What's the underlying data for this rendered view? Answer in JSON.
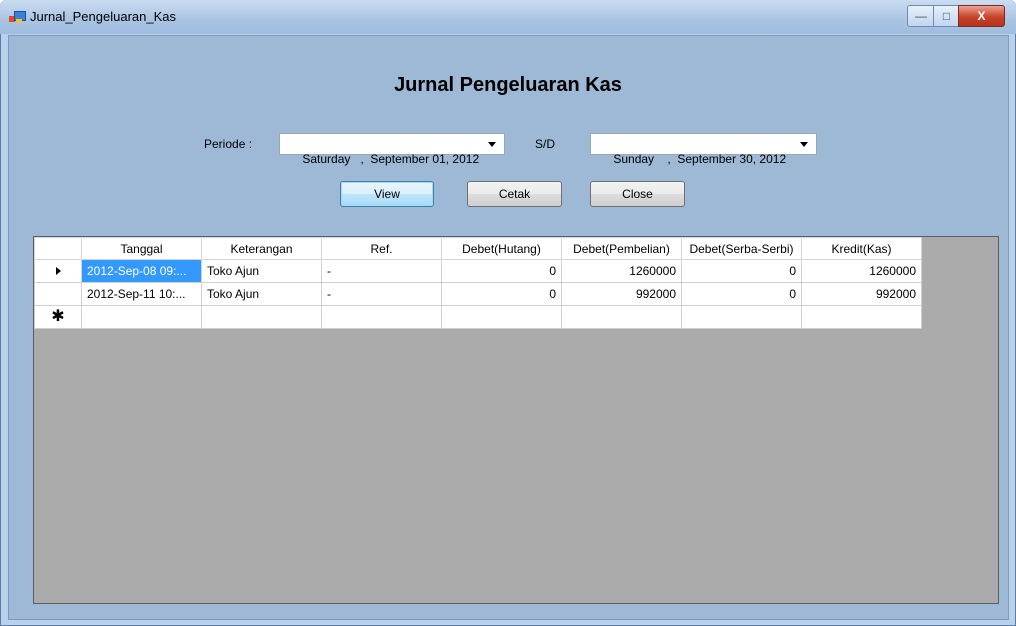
{
  "window": {
    "title": "Jurnal_Pengeluaran_Kas",
    "min_glyph": "—",
    "max_glyph": "□",
    "close_glyph": "X"
  },
  "heading": "Jurnal Pengeluaran Kas",
  "filter": {
    "periode_label": "Periode :",
    "date_from": "Saturday   ,  September 01, 2012",
    "sd_label": "S/D",
    "date_to": "Sunday    ,  September 30, 2012"
  },
  "buttons": {
    "view": "View",
    "cetak": "Cetak",
    "close": "Close"
  },
  "grid": {
    "columns": [
      "Tanggal",
      "Keterangan",
      "Ref.",
      "Debet(Hutang)",
      "Debet(Pembelian)",
      "Debet(Serba-Serbi)",
      "Kredit(Kas)"
    ],
    "rows": [
      [
        "2012-Sep-08 09:...",
        "Toko Ajun",
        "-",
        "0",
        "1260000",
        "0",
        "1260000"
      ],
      [
        "2012-Sep-11 10:...",
        "Toko Ajun",
        "-",
        "0",
        "992000",
        "0",
        "992000"
      ]
    ],
    "current_row_marker": "▶",
    "new_row_marker": "✱"
  },
  "colors": {
    "client_bg": "#9eb9d6",
    "grid_bg": "#ababab",
    "selection": "#3399ff"
  }
}
